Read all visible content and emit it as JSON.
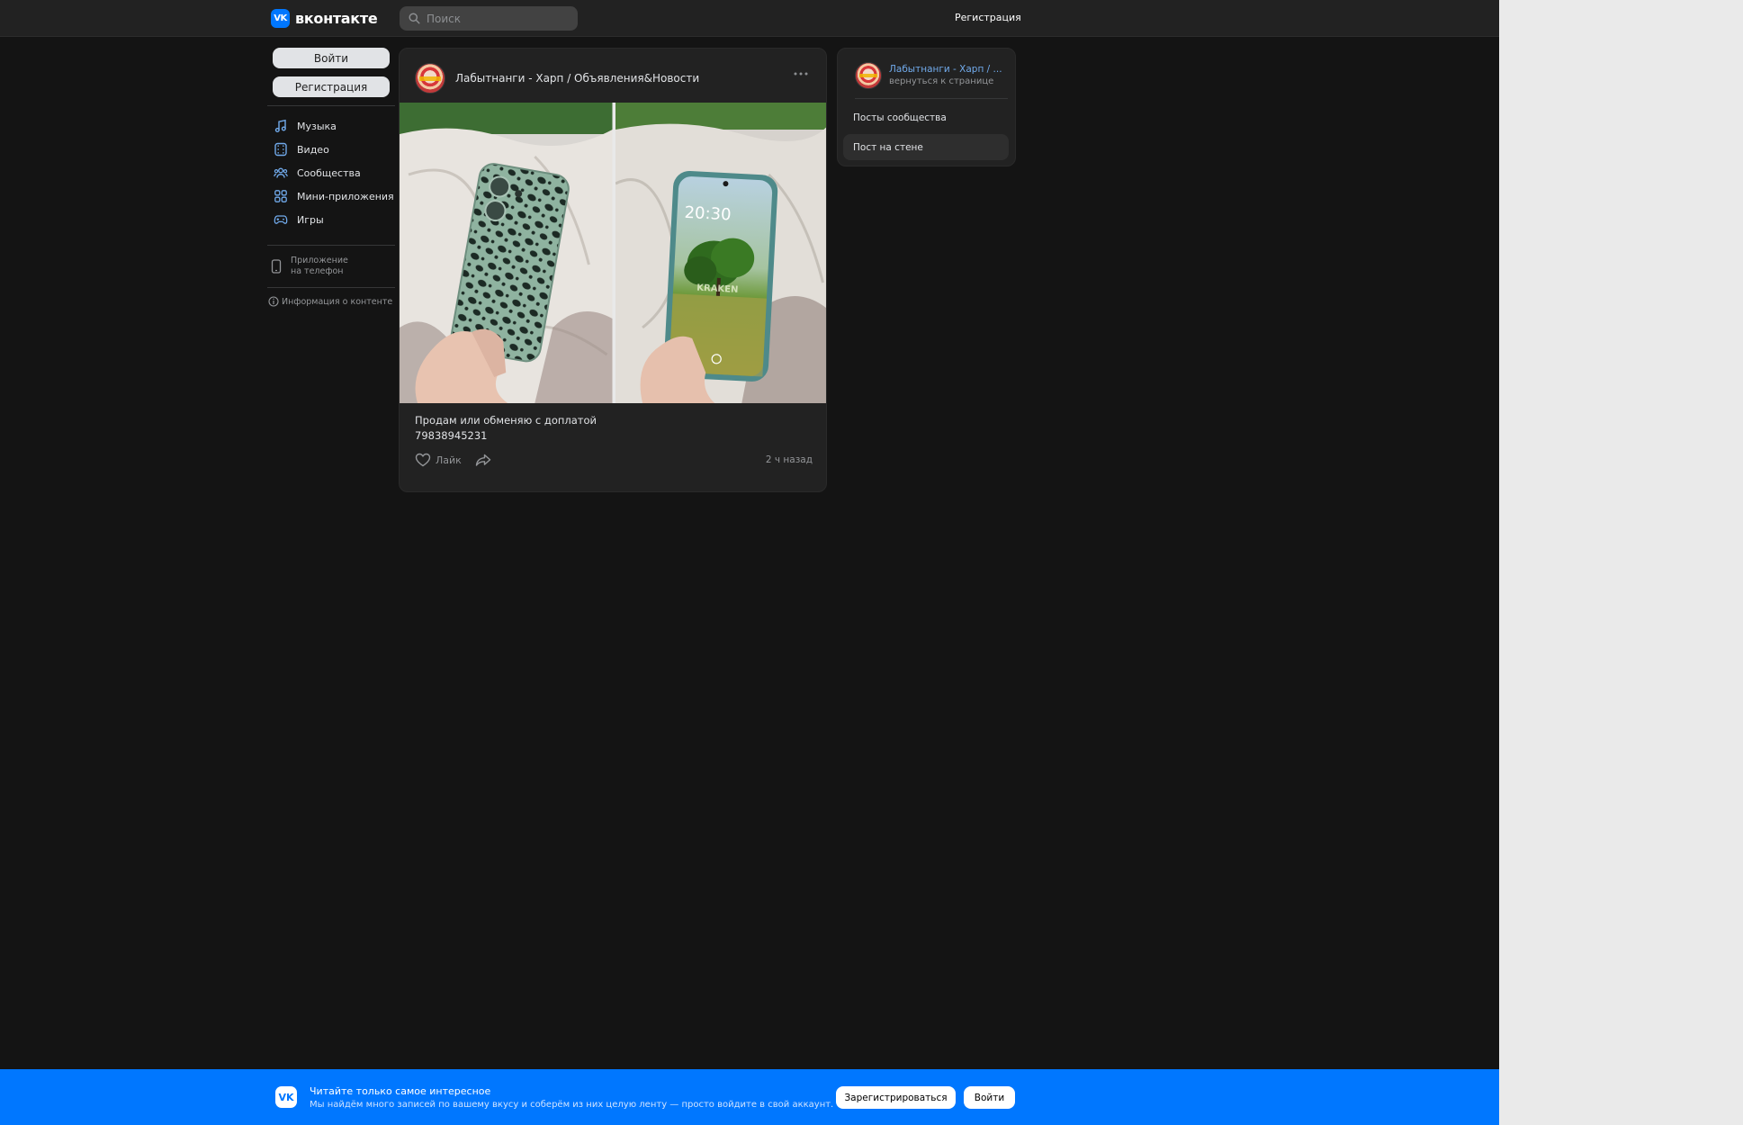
{
  "header": {
    "logo_mark": "VK",
    "logo_text": "вконтакте",
    "search_placeholder": "Поиск",
    "register_link": "Регистрация"
  },
  "leftnav": {
    "login_button": "Войти",
    "register_button": "Регистрация",
    "items": [
      {
        "label": "Музыка",
        "icon": "music-icon"
      },
      {
        "label": "Видео",
        "icon": "video-icon"
      },
      {
        "label": "Сообщества",
        "icon": "communities-icon"
      },
      {
        "label": "Мини-приложения",
        "icon": "apps-icon"
      },
      {
        "label": "Игры",
        "icon": "games-icon"
      }
    ],
    "app_link": "Приложение\nна телефон",
    "info_link": "Информация о контенте"
  },
  "post": {
    "author": "Лабытнанги - Харп / Объявления&Новости",
    "text_line1": "Продам или обменяю с доплатой",
    "text_line2": "79838945231",
    "like_label": "Лайк",
    "time": "2 ч назад",
    "photo_clock": "20:30",
    "photo_watermark": "KRAKEN"
  },
  "widget": {
    "name": "Лабытнанги - Харп / ...",
    "back": "вернуться к странице",
    "items": [
      "Посты сообщества",
      "Пост на стене"
    ]
  },
  "banner": {
    "logo_mark": "VK",
    "title": "Читайте только самое интересное",
    "subtitle": "Мы найдём много записей по вашему вкусу и соберём из них целую ленту — просто войдите в свой аккаунт.",
    "register_button": "Зарегистрироваться",
    "login_button": "Войти"
  },
  "colors": {
    "accent": "#0077ff",
    "link": "#71aaeb",
    "background": "#141414",
    "card": "#222222"
  }
}
